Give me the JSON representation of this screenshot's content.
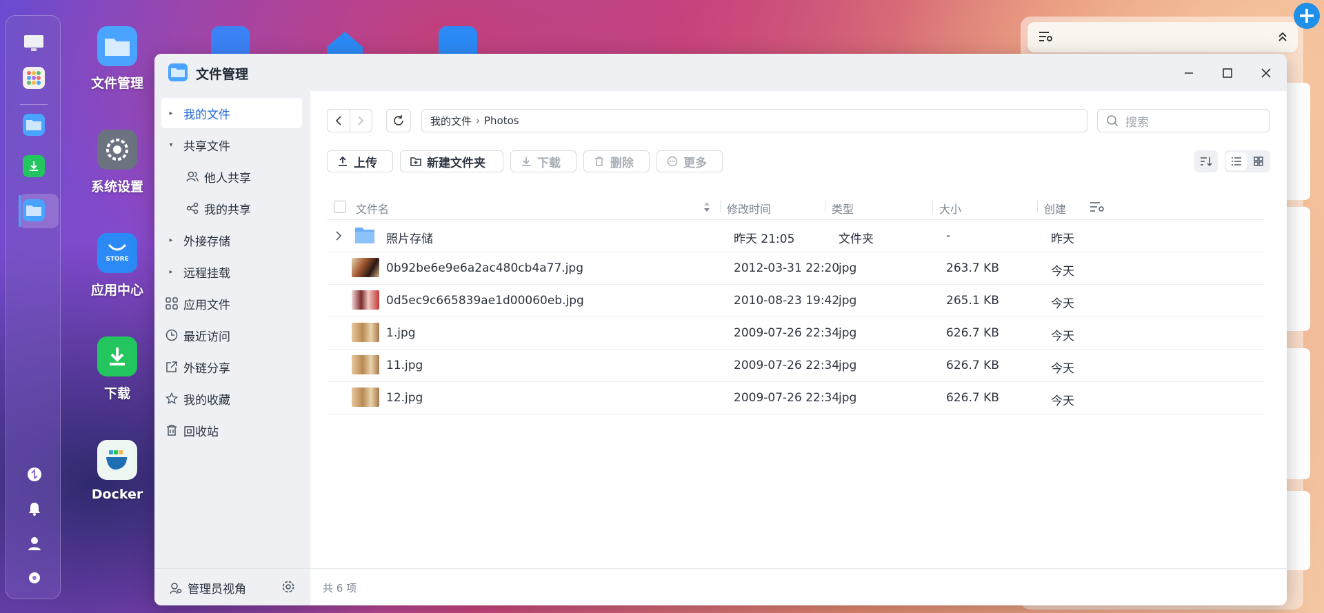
{
  "desktop": {
    "icons": [
      {
        "label": "文件管理"
      },
      {
        "label": "系统设置"
      },
      {
        "label": "应用中心",
        "badge": "STORE"
      },
      {
        "label": "下载"
      },
      {
        "label": "Docker"
      }
    ]
  },
  "window": {
    "title": "文件管理"
  },
  "sidebar": {
    "items": [
      {
        "label": "我的文件"
      },
      {
        "label": "共享文件"
      },
      {
        "label": "他人共享"
      },
      {
        "label": "我的共享"
      },
      {
        "label": "外接存储"
      },
      {
        "label": "远程挂载"
      },
      {
        "label": "应用文件"
      },
      {
        "label": "最近访问"
      },
      {
        "label": "外链分享"
      },
      {
        "label": "我的收藏"
      },
      {
        "label": "回收站"
      }
    ],
    "footer_label": "管理员视角"
  },
  "path": {
    "root": "我的文件",
    "current": "Photos"
  },
  "search": {
    "placeholder": "搜索"
  },
  "toolbar": {
    "upload": "上传",
    "new_folder": "新建文件夹",
    "download": "下载",
    "delete": "删除",
    "more": "更多"
  },
  "table": {
    "columns": [
      "文件名",
      "修改时间",
      "类型",
      "大小",
      "创建"
    ],
    "rows": [
      {
        "name": "照片存储",
        "modified": "昨天 21:05",
        "type": "文件夹",
        "size": "-",
        "created": "昨天",
        "kind": "folder"
      },
      {
        "name": "0b92be6e9e6a2ac480cb4a77.jpg",
        "modified": "2012-03-31 22:20",
        "type": "jpg",
        "size": "263.7 KB",
        "created": "今天",
        "kind": "image"
      },
      {
        "name": "0d5ec9c665839ae1d00060eb.jpg",
        "modified": "2010-08-23 19:42",
        "type": "jpg",
        "size": "265.1 KB",
        "created": "今天",
        "kind": "image"
      },
      {
        "name": "1.jpg",
        "modified": "2009-07-26 22:34",
        "type": "jpg",
        "size": "626.7 KB",
        "created": "今天",
        "kind": "image"
      },
      {
        "name": "11.jpg",
        "modified": "2009-07-26 22:34",
        "type": "jpg",
        "size": "626.7 KB",
        "created": "今天",
        "kind": "image"
      },
      {
        "name": "12.jpg",
        "modified": "2009-07-26 22:34",
        "type": "jpg",
        "size": "626.7 KB",
        "created": "今天",
        "kind": "image"
      }
    ]
  },
  "status": {
    "count": "共 6 项"
  }
}
